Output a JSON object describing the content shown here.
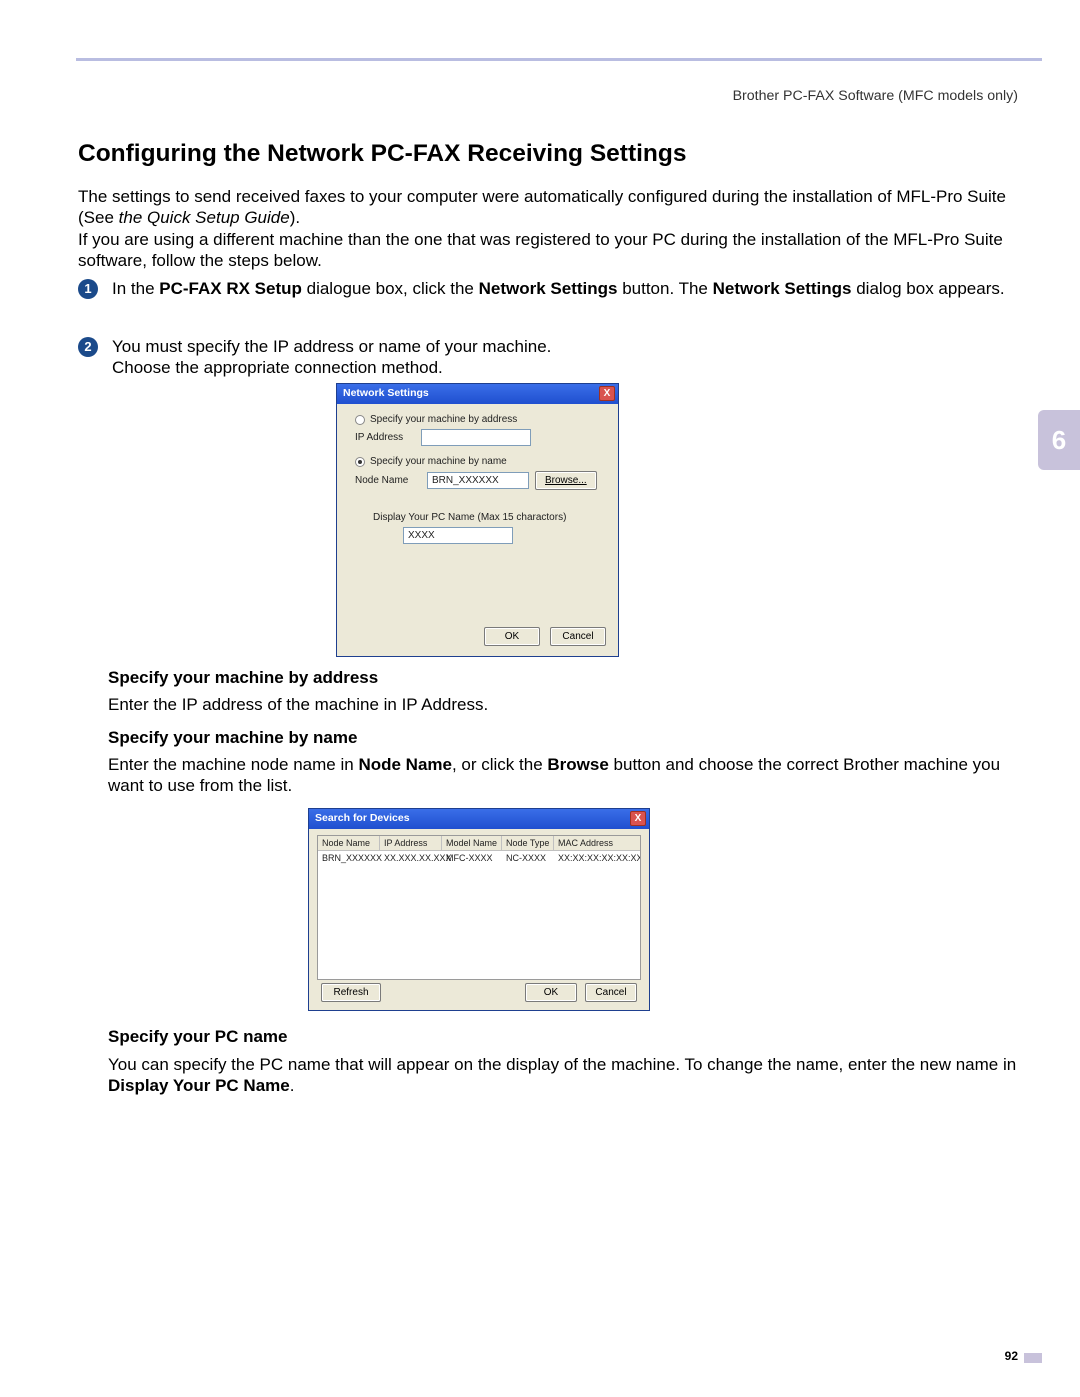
{
  "header": {
    "right": "Brother PC-FAX Software (MFC models only)"
  },
  "title": "Configuring the Network PC-FAX Receiving Settings",
  "intro": {
    "line1a": "The settings to send received faxes to your computer were automatically configured during the installation of MFL-Pro Suite (See ",
    "line1b": "the Quick Setup Guide",
    "line1c": ").",
    "line2": "If you are using a different machine than the one that was registered to your PC during the installation of the MFL-Pro Suite software, follow the steps below."
  },
  "steps": {
    "s1": {
      "num": "1",
      "a": "In the ",
      "b": "PC-FAX RX Setup",
      "c": " dialogue box, click the ",
      "d": "Network Settings",
      "e": " button. The ",
      "f": "Network Settings",
      "g": " dialog box appears."
    },
    "s2": {
      "num": "2",
      "a": "You must specify the IP address or name of your machine.",
      "b": "Choose the appropriate connection method."
    }
  },
  "dialog1": {
    "title": "Network Settings",
    "opt_address": "Specify your machine by address",
    "ip_label": "IP Address",
    "ip_value": "",
    "opt_name": "Specify your machine by name",
    "node_label": "Node Name",
    "node_value": "BRN_XXXXXX",
    "browse": "Browse...",
    "display_label": "Display Your PC Name (Max 15 charactors)",
    "display_value": "XXXX",
    "ok": "OK",
    "cancel": "Cancel",
    "close_x": "X"
  },
  "sections": {
    "addr_h": "Specify your machine by address",
    "addr_b": "Enter the IP address of the machine in IP Address.",
    "name_h": "Specify your machine by name",
    "name_b_a": "Enter the machine node name in ",
    "name_b_b": "Node Name",
    "name_b_c": ", or click the ",
    "name_b_d": "Browse",
    "name_b_e": " button and choose the correct Brother machine you want to use from the list.",
    "pc_h": "Specify your PC name",
    "pc_b_a": "You can specify the PC name that will appear on the display of the machine. To change the name, enter the new name in ",
    "pc_b_b": "Display Your PC Name",
    "pc_b_c": "."
  },
  "dialog2": {
    "title": "Search for Devices",
    "close_x": "X",
    "cols": [
      "Node Name",
      "IP Address",
      "Model Name",
      "Node Type",
      "MAC Address"
    ],
    "row": [
      "BRN_XXXXXX",
      "XX.XXX.XX.XXX",
      "MFC-XXXX",
      "NC-XXXX",
      "XX:XX:XX:XX:XX:XX"
    ],
    "refresh": "Refresh",
    "ok": "OK",
    "cancel": "Cancel"
  },
  "sidetab": "6",
  "page_number": "92"
}
